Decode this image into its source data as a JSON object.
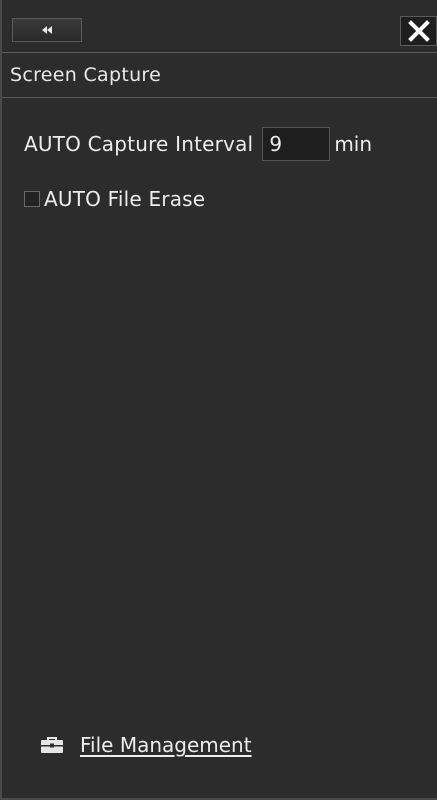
{
  "toolbar": {
    "collapse_icon": "double-chevron-left-icon",
    "close_icon": "close-icon"
  },
  "panel": {
    "title": "Screen Capture"
  },
  "settings": {
    "interval_label": "AUTO Capture Interval",
    "interval_value": "9",
    "interval_unit": "min",
    "erase_label": "AUTO File Erase",
    "erase_checked": false
  },
  "footer": {
    "file_management_label": "File Management",
    "file_management_icon": "briefcase-icon"
  },
  "colors": {
    "background": "#2c2c2c",
    "text": "#ececec",
    "border": "#5a5a5a"
  }
}
